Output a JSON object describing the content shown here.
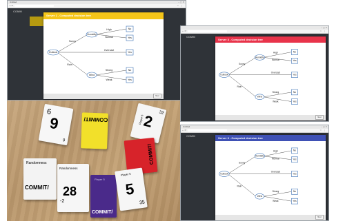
{
  "windows": [
    {
      "id": "w1",
      "window_title": "Untitled",
      "page_heading": "COMM",
      "header_text": "Server 1 - Computed decision tree",
      "header_color": "#f5c518",
      "tree": {
        "root": "Outlook",
        "branches": [
          "Sunny",
          "Overcast",
          "Rain"
        ],
        "humidity": "Humidity",
        "humidity_values": [
          "High",
          "Normal"
        ],
        "wind": "Wind",
        "wind_values": [
          "Strong",
          "Weak"
        ],
        "leaves": [
          "No",
          "Yes",
          "Yes",
          "No",
          "Yes"
        ]
      },
      "next_label": "Next"
    },
    {
      "id": "w2",
      "window_title": "",
      "page_heading": "COMM",
      "header_text": "Server 3 - Computed decision tree",
      "header_color": "#e8334a",
      "tree": {
        "root": "Outlook",
        "branches": [
          "Sunny",
          "Overcast",
          "Rain"
        ],
        "humidity": "Humidity",
        "humidity_values": [
          "High",
          "Normal"
        ],
        "wind": "Wind",
        "wind_values": [
          "Strong",
          "Weak"
        ],
        "leaves": [
          "No",
          "Yes",
          "Yes",
          "No",
          "Yes"
        ]
      },
      "next_label": "Next"
    },
    {
      "id": "w3",
      "window_title": "Untitled",
      "page_heading": "COMM",
      "header_text": "Server 3 - Computed decision tree",
      "header_color": "#3f51b5",
      "tree": {
        "root": "Outlook",
        "branches": [
          "Sunny",
          "Overcast",
          "Rain"
        ],
        "humidity": "Humidity",
        "humidity_values": [
          "High",
          "Normal"
        ],
        "wind": "Wind",
        "wind_values": [
          "Strong",
          "Weak"
        ],
        "leaves": [
          "No",
          "Yes",
          "Yes",
          "No",
          "Yes"
        ]
      },
      "next_label": "Next"
    }
  ],
  "photo": {
    "cards": {
      "c1": {
        "top": "9",
        "bottom": "9",
        "big": "6"
      },
      "c2": {
        "text": "COMMIT/",
        "color": "#f2e02a"
      },
      "c3": {
        "label": "Player 5",
        "big": "2",
        "small": "32"
      },
      "c4": {
        "text": "COMMIT/",
        "color": "#d7232a"
      },
      "c5": {
        "label": "Randomness",
        "text": "COMMIT/"
      },
      "c6": {
        "label": "Randomness",
        "big": "28",
        "small": "-2"
      },
      "c7": {
        "label": "Player 5",
        "text": "COMMIT/",
        "color": "#4a2a8a"
      },
      "c8": {
        "label": "Player 5",
        "big": "5",
        "small": "35"
      }
    }
  }
}
